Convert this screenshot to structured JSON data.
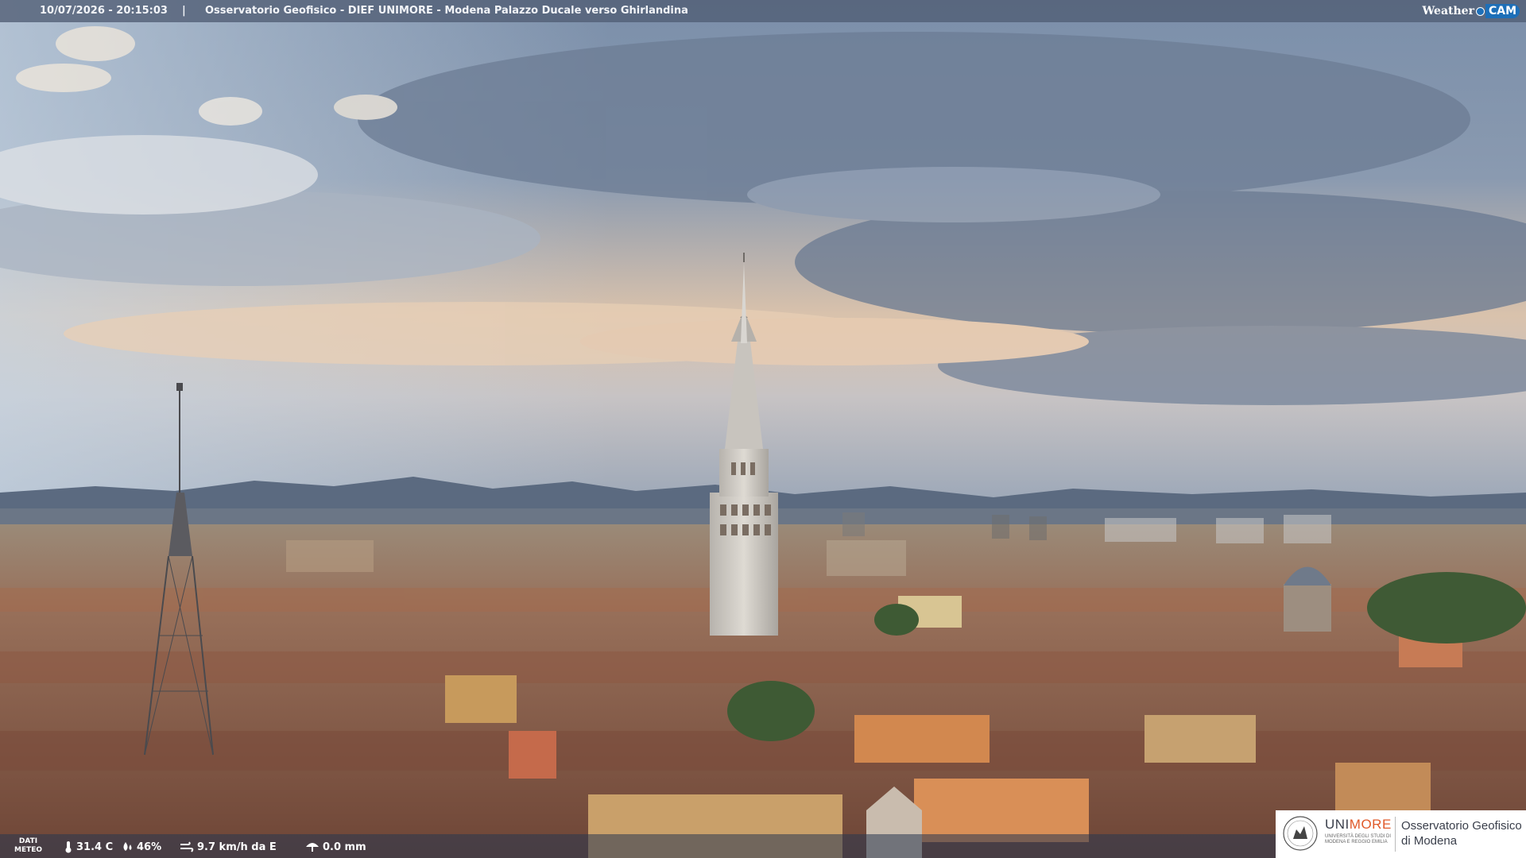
{
  "header": {
    "timestamp": "10/07/2026 - 20:15:03",
    "separator": "|",
    "title": "Osservatorio Geofisico - DIEF UNIMORE - Modena Palazzo Ducale verso Ghirlandina",
    "logo_weather": "Weather",
    "logo_cam": "CAM"
  },
  "weather": {
    "dati_line1": "DATI",
    "dati_line2": "METEO",
    "temperature": "31.4 C",
    "humidity": "46%",
    "wind": "9.7 km/h da E",
    "rain": "0.0 mm"
  },
  "branding": {
    "uni": "UNI",
    "more": "MORE",
    "university_line": "UNIVERSITÀ DEGLI STUDI DI MODENA E REGGIO EMILIA",
    "observatory_line1": "Osservatorio Geofisico",
    "observatory_line2": "di Modena"
  },
  "colors": {
    "sky_top": "#6f819c",
    "sky_glow": "#e7c8a8",
    "roofs": "#8a5a42",
    "mountains": "#5b6a80",
    "accent_orange": "#e05a2a",
    "accent_blue": "#1d6fb8"
  }
}
